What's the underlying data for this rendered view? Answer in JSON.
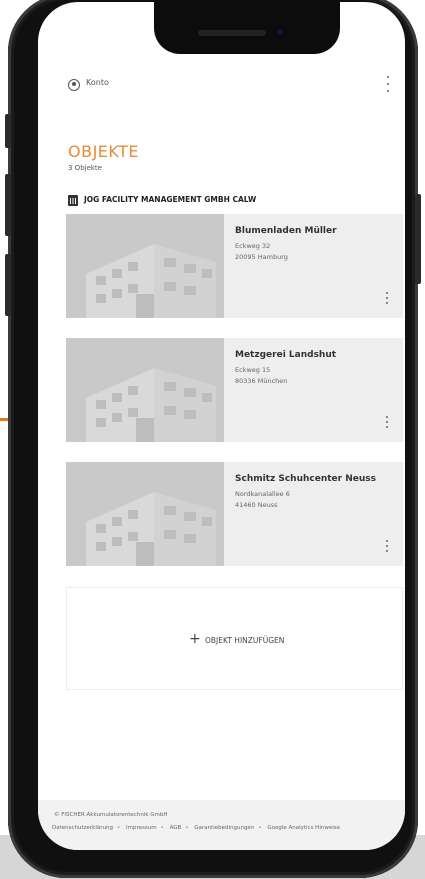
{
  "account": {
    "label": "Konto"
  },
  "page": {
    "title": "OBJEKTE",
    "count": "3 Objekte"
  },
  "company": {
    "name": "JOG FACILITY MANAGEMENT GMBH CALW"
  },
  "objects": [
    {
      "name": "Blumenladen Müller",
      "street": "Eckweg 32",
      "city": "20095 Hamburg"
    },
    {
      "name": "Metzgerei Landshut",
      "street": "Eckweg 15",
      "city": "80336 München"
    },
    {
      "name": "Schmitz Schuhcenter Neuss",
      "street": "Nordkanalallee 6",
      "city": "41460 Neuss"
    }
  ],
  "add_button": {
    "plus": "+",
    "label": "OBJEKT HINZUFÜGEN"
  },
  "footer": {
    "copyright": "© FISCHER Akkumulatorentechnik GmbH",
    "links": [
      "Datenschutzerklärung",
      "Impressum",
      "AGB",
      "Garantiebedingungen",
      "Google Analytics Hinweise"
    ],
    "separator": "•"
  },
  "colors": {
    "accent": "#e88a3a",
    "card_bg": "#eeeeee",
    "image_bg": "#c9c9c9"
  }
}
